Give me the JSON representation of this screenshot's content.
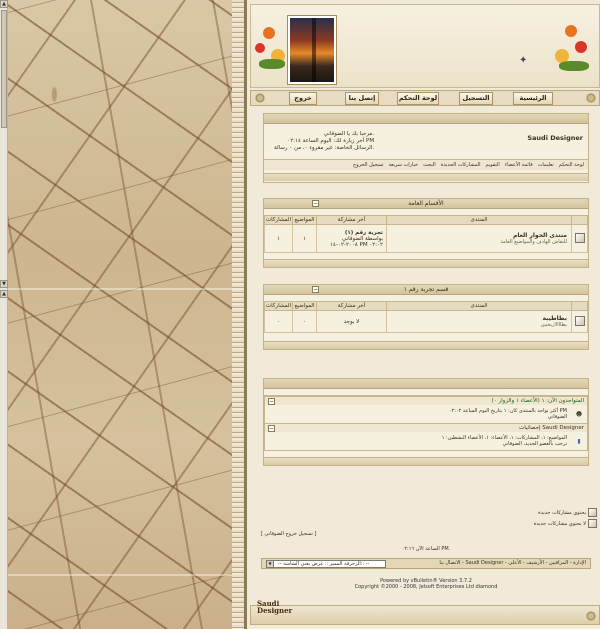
{
  "nav": {
    "home": "الرئيسية",
    "register": "التسجيل",
    "control_panel": "لوحة التحكم",
    "contact": "إتصل بنا",
    "logout": "خروج"
  },
  "welcome_box": {
    "username": "Saudi Designer",
    "greeting": "مرحبا بك يا الضوقاني.",
    "last_visit": "آخر زيارة لك: اليوم الساعة ٠٢:١٤ PM",
    "messages": "الرسائل الخاصة: غير مقروء ٠، من ٠ رسالة.",
    "links": [
      "لوحة التحكم",
      "تعليمات",
      "قائمة الأعضاء",
      "التقويم",
      "المشاركات الجديدة",
      "البحث",
      "خيارات سريعة",
      "تسجيل الخروج"
    ]
  },
  "section1": {
    "title": "الأقسام العامة",
    "headers": {
      "forum": "المنتدى",
      "last_post": "آخر مشاركة",
      "threads": "المواضيع",
      "posts": "المشاركات"
    },
    "row": {
      "name": "منتدى الحوار العام",
      "desc": "للنقاش الهادف والمواضيع العامة",
      "last_title": "تجربة رقم (١)",
      "last_by": "بواسطة الضوقاني",
      "last_date": "٢٠٠٨-٠٢-١٤ PM ٠٢:٠٢",
      "threads": "١",
      "posts": "١"
    }
  },
  "section2": {
    "title": "قسم تجربة رقم ١",
    "headers": {
      "forum": "المنتدى",
      "last_post": "آخر مشاركة",
      "threads": "المواضيع",
      "posts": "المشاركات"
    },
    "row": {
      "name": "بطاطيبة",
      "desc": "بطاااااريخنين",
      "last": "لا يوجد",
      "threads": "٠",
      "posts": "٠"
    }
  },
  "section3": {
    "online_title": "المتواجدون الآن: ١ (الأعضاء ١ والزوار ٠)",
    "online_text": "أكثر تواجد بالمنتدى كان: ١ بتاريخ اليوم الساعة ٠٢:٠٢ PM",
    "online_user": "الضوقاني",
    "stats_title": "إحصائيات Saudi Designer",
    "stats_text": "المواضيع: ١، المشاركات: ١، الأعضاء: ١، الأعضاء النشطين: ١",
    "stats_welcome": "ترحب بالعضو الجديد، الضوقاني"
  },
  "legend": {
    "new_posts": "يحتوي مشاركات جديدة",
    "no_new_posts": "لا يحتوي مشاركات جديدة"
  },
  "logout_link": "[ تسجيل خروج الضوقاني ]",
  "time_line": "الساعة الآن ٠٢:١٦ PM.",
  "footer": {
    "links": "الاتصال بنا - Saudi Designer - الإدارة - المراقبين - الأرشيف - الأعلى",
    "select_label": "-- الزخرفة المميز :: غرض يعني الشاشة:: --"
  },
  "credit": {
    "line1": "Powered by vBulletin® Version 3.7.2",
    "line2": "Copyright ©2000 - 2008, Jelsoft Enterprises Ltd diamond"
  },
  "logo": {
    "line1": "Saudi",
    "line2": "Designer"
  },
  "colors": {
    "panel_bg": "#f1ead8",
    "border": "#c3b38b",
    "accent": "#8a7a58"
  }
}
